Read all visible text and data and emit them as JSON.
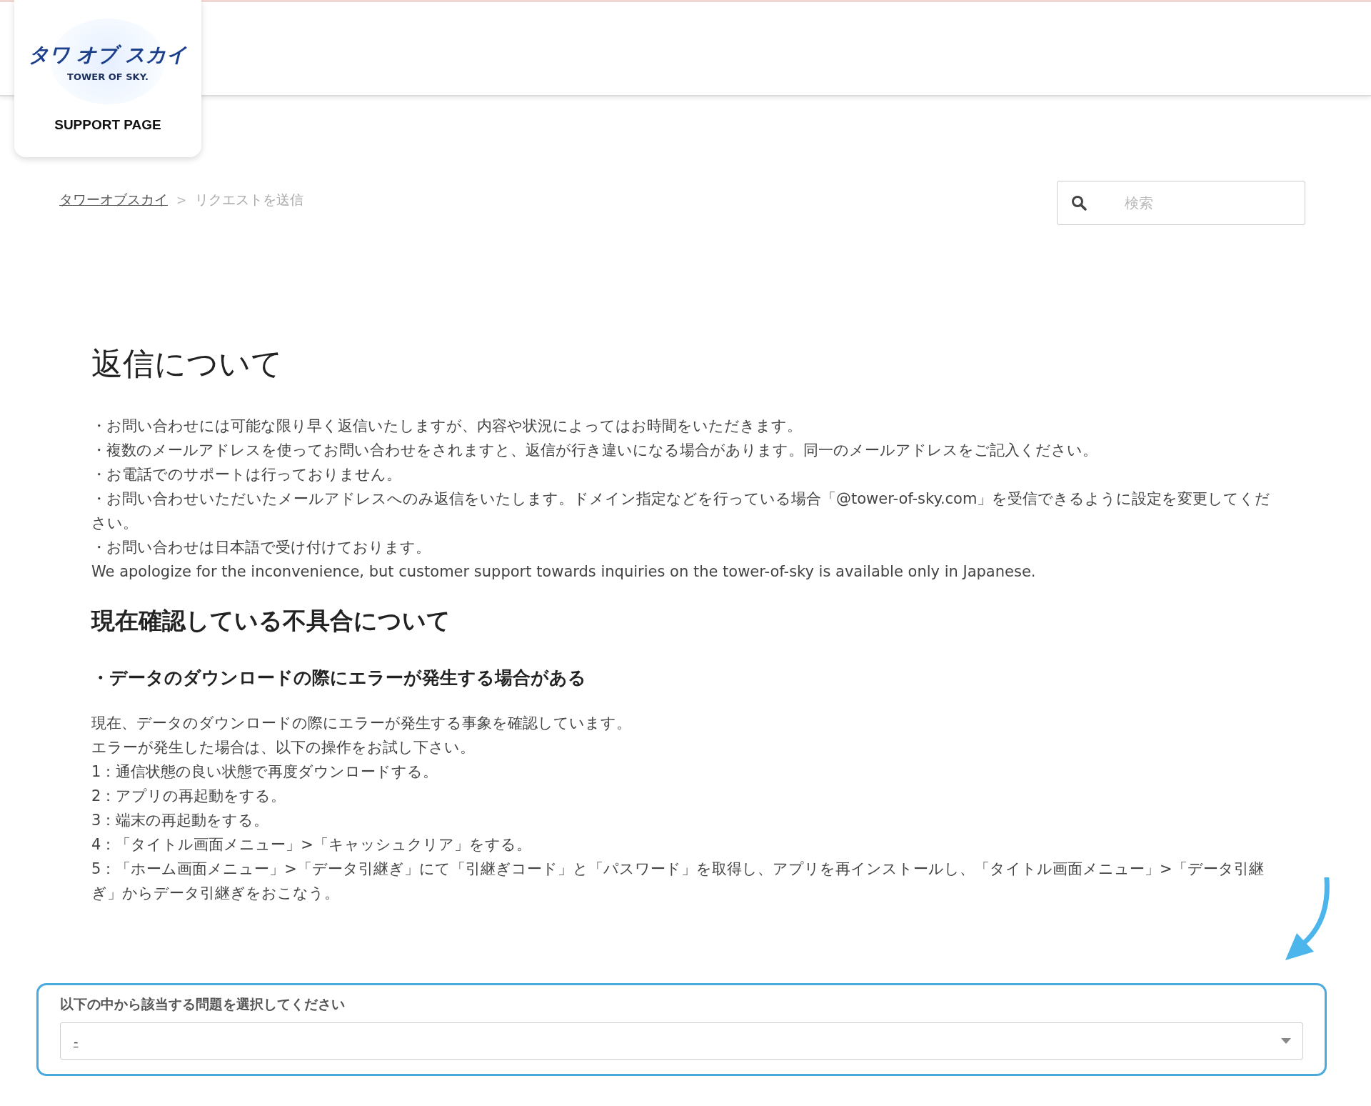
{
  "header": {
    "logo": {
      "title": "タワ オブ スカイ",
      "subtitle": "TOWER OF SKY."
    },
    "label": "SUPPORT PAGE"
  },
  "breadcrumb": [
    {
      "label": "タワーオブスカイ",
      "link": true
    },
    {
      "label": "リクエストを送信",
      "link": false
    }
  ],
  "breadcrumb_separator": ">",
  "search": {
    "placeholder": "検索"
  },
  "sections": [
    {
      "kind": "h1",
      "text": "返信について"
    },
    {
      "kind": "p",
      "lines": [
        "・お問い合わせには可能な限り早く返信いたしますが、内容や状況によってはお時間をいただきます。",
        "・複数のメールアドレスを使ってお問い合わせをされますと、返信が行き違いになる場合があります。同一のメールアドレスをご記入ください。",
        "・お電話でのサポートは行っておりません。",
        "・お問い合わせいただいたメールアドレスへのみ返信をいたします。ドメイン指定などを行っている場合「@tower-of-sky.com」を受信できるように設定を変更してください。",
        "・お問い合わせは日本語で受け付けております。",
        "We apologize for the inconvenience, but customer support towards inquiries on the tower-of-sky is available only in Japanese."
      ]
    },
    {
      "kind": "h2",
      "text": "現在確認している不具合について"
    },
    {
      "kind": "h3",
      "text": "・データのダウンロードの際にエラーが発生する場合がある"
    },
    {
      "kind": "p",
      "lines": [
        "現在、データのダウンロードの際にエラーが発生する事象を確認しています。",
        "エラーが発生した場合は、以下の操作をお試し下さい。",
        "1：通信状態の良い状態で再度ダウンロードする。",
        "2：アプリの再起動をする。",
        "3：端末の再起動をする。",
        "4：「タイトル画面メニュー」>「キャッシュクリア」をする。",
        "5：「ホーム画面メニュー」>「データ引継ぎ」にて「引継ぎコード」と「パスワード」を取得し、アプリを再インストールし、「タイトル画面メニュー」>「データ引継ぎ」からデータ引継ぎをおこなう。"
      ]
    }
  ],
  "form": {
    "label": "以下の中から該当する問題を選択してください",
    "select_value": "-"
  }
}
